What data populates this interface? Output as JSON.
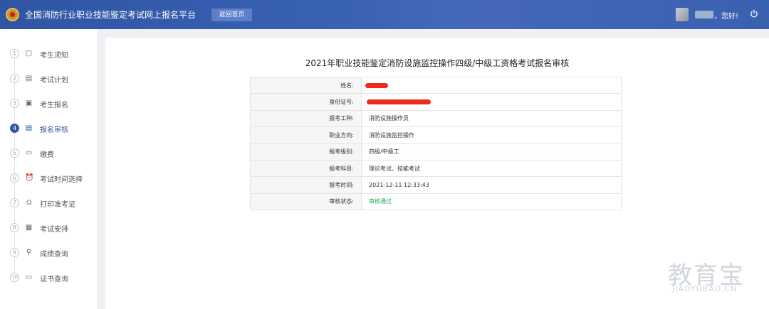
{
  "header": {
    "app_title": "全国消防行业职业技能鉴定考试网上报名平台",
    "home_button": "返回首页",
    "greeting": "，您好!"
  },
  "sidebar": {
    "items": [
      {
        "num": "1",
        "label": "考生须知",
        "icon": "notice-icon"
      },
      {
        "num": "2",
        "label": "考试计划",
        "icon": "plan-icon"
      },
      {
        "num": "3",
        "label": "考生报名",
        "icon": "register-icon"
      },
      {
        "num": "4",
        "label": "报名审核",
        "icon": "review-icon",
        "active": true
      },
      {
        "num": "5",
        "label": "缴费",
        "icon": "payment-icon"
      },
      {
        "num": "6",
        "label": "考试时间选择",
        "icon": "alarm-clock-icon"
      },
      {
        "num": "7",
        "label": "打印准考证",
        "icon": "printer-icon"
      },
      {
        "num": "8",
        "label": "考试安排",
        "icon": "schedule-icon"
      },
      {
        "num": "9",
        "label": "成绩查询",
        "icon": "search-icon"
      },
      {
        "num": "10",
        "label": "证书查询",
        "icon": "certificate-icon"
      }
    ]
  },
  "main": {
    "title": "2021年职业技能鉴定消防设施监控操作四级/中级工资格考试报名审核",
    "rows": [
      {
        "label": "姓名:",
        "value": ""
      },
      {
        "label": "身份证号:",
        "value": ""
      },
      {
        "label": "报考工种:",
        "value": "消防设施操作员"
      },
      {
        "label": "职业方向:",
        "value": "消防设施监控操作"
      },
      {
        "label": "报考级别:",
        "value": "四级/中级工"
      },
      {
        "label": "报考科目:",
        "value": "理论考试、技能考试"
      },
      {
        "label": "报考时间:",
        "value": "2021-12-11 12:33:43"
      },
      {
        "label": "审核状态:",
        "value": "审核通过"
      }
    ]
  },
  "colors": {
    "header_blue": "#2f55a4",
    "status_green": "#1fae5a",
    "redaction_red": "#f0291f"
  },
  "watermark": {
    "cn": "教育宝",
    "en": "JIAOYUBAO.CN"
  }
}
